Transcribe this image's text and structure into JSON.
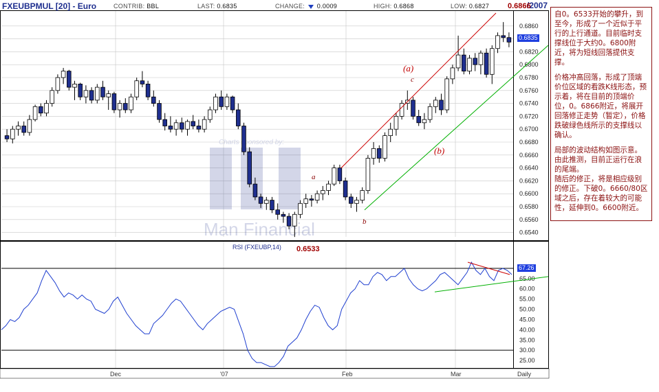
{
  "header": {
    "title": "FXEUBPMUL [20] - Euro",
    "contrib_label": "CONTRIB:",
    "contrib_value": "BBL",
    "last_label": "LAST:",
    "last_value": "0.6835",
    "change_label": "CHANGE:",
    "change_value": "0.0009",
    "high_label": "HIGH:",
    "high_value": "0.6868",
    "low_label": "LOW:",
    "low_value": "0.6827",
    "year": "/2007"
  },
  "annotations": {
    "peak_value": "0.6866",
    "low_value": "0.6533",
    "wave_a_big": "(a)",
    "wave_b_big": "(b)",
    "wave_a_small": "a",
    "wave_b_small": "b",
    "wave_c_small": "c",
    "last_price_box": "0.6835",
    "rsi_value_box": "67.26"
  },
  "watermark": {
    "sponsor_text": "Charts sponsored by:",
    "brand_text": "Man Financial"
  },
  "note": {
    "p1": "自0。6533开始的攀升，到至今，形成了一个近似于平行的上行通道。目前临时支撑线位于大约0。6800附近，将为短线回落提供支撑。",
    "p2": "价格冲高回落，形成了顶端价位区域的看跌K线形态，预示着，将在目前的顶端价位，0。6866附近，将展开回落修正走势（暂定），价格跌破绿色线所示的支撑线以确认。",
    "p3": "局部的波动结构如图示意。由此推测，目前正运行在浪的尾端。",
    "p4": "随后的修正，将是相应级别的修正。下破0。6660/80区域之后，存在着较大的可能性，延伸到0。6600附近。"
  },
  "colors": {
    "up_candle": "#ffffff",
    "down_candle": "#1f2f8f",
    "rsi_line": "#1f3fcf",
    "resistance_line": "#cc0000",
    "support_line": "#00b000",
    "grid": "#c8c8c8",
    "note_text": "#8b1010"
  },
  "chart_data": [
    {
      "type": "candlestick",
      "title": "FXEUBPMUL [20] - Euro",
      "frequency": "Daily",
      "ylim": [
        0.653,
        0.688
      ],
      "y_ticks": [
        0.654,
        0.656,
        0.658,
        0.66,
        0.662,
        0.664,
        0.666,
        0.668,
        0.67,
        0.672,
        0.674,
        0.676,
        0.678,
        0.68,
        0.682,
        0.684,
        0.686
      ],
      "x_ticks": [
        "Dec",
        "'07",
        "Feb",
        "Mar",
        "Daily"
      ],
      "grid": true,
      "candles": [
        {
          "o": 0.669,
          "h": 0.67,
          "l": 0.668,
          "c": 0.6685
        },
        {
          "o": 0.6685,
          "h": 0.6705,
          "l": 0.6678,
          "c": 0.67
        },
        {
          "o": 0.67,
          "h": 0.6712,
          "l": 0.669,
          "c": 0.6705
        },
        {
          "o": 0.6705,
          "h": 0.6712,
          "l": 0.669,
          "c": 0.6695
        },
        {
          "o": 0.6695,
          "h": 0.6722,
          "l": 0.669,
          "c": 0.6715
        },
        {
          "o": 0.6715,
          "h": 0.6738,
          "l": 0.6712,
          "c": 0.6735
        },
        {
          "o": 0.6735,
          "h": 0.674,
          "l": 0.672,
          "c": 0.6725
        },
        {
          "o": 0.6725,
          "h": 0.6745,
          "l": 0.672,
          "c": 0.674
        },
        {
          "o": 0.674,
          "h": 0.6765,
          "l": 0.6735,
          "c": 0.676
        },
        {
          "o": 0.676,
          "h": 0.6785,
          "l": 0.6755,
          "c": 0.678
        },
        {
          "o": 0.678,
          "h": 0.6795,
          "l": 0.677,
          "c": 0.679
        },
        {
          "o": 0.679,
          "h": 0.6792,
          "l": 0.676,
          "c": 0.6765
        },
        {
          "o": 0.6765,
          "h": 0.6775,
          "l": 0.6745,
          "c": 0.677
        },
        {
          "o": 0.677,
          "h": 0.6772,
          "l": 0.6745,
          "c": 0.675
        },
        {
          "o": 0.675,
          "h": 0.6768,
          "l": 0.674,
          "c": 0.676
        },
        {
          "o": 0.676,
          "h": 0.6765,
          "l": 0.674,
          "c": 0.6745
        },
        {
          "o": 0.6745,
          "h": 0.677,
          "l": 0.674,
          "c": 0.6765
        },
        {
          "o": 0.6765,
          "h": 0.6775,
          "l": 0.6745,
          "c": 0.675
        },
        {
          "o": 0.675,
          "h": 0.676,
          "l": 0.673,
          "c": 0.6755
        },
        {
          "o": 0.6755,
          "h": 0.6758,
          "l": 0.6725,
          "c": 0.673
        },
        {
          "o": 0.673,
          "h": 0.6745,
          "l": 0.6718,
          "c": 0.674
        },
        {
          "o": 0.674,
          "h": 0.6748,
          "l": 0.6725,
          "c": 0.673
        },
        {
          "o": 0.673,
          "h": 0.6755,
          "l": 0.6725,
          "c": 0.675
        },
        {
          "o": 0.675,
          "h": 0.678,
          "l": 0.6745,
          "c": 0.6775
        },
        {
          "o": 0.6775,
          "h": 0.679,
          "l": 0.6765,
          "c": 0.677
        },
        {
          "o": 0.677,
          "h": 0.6775,
          "l": 0.6745,
          "c": 0.675
        },
        {
          "o": 0.675,
          "h": 0.676,
          "l": 0.6735,
          "c": 0.674
        },
        {
          "o": 0.674,
          "h": 0.6745,
          "l": 0.671,
          "c": 0.6715
        },
        {
          "o": 0.6715,
          "h": 0.6725,
          "l": 0.6698,
          "c": 0.6705
        },
        {
          "o": 0.6705,
          "h": 0.672,
          "l": 0.6695,
          "c": 0.67
        },
        {
          "o": 0.67,
          "h": 0.6715,
          "l": 0.669,
          "c": 0.671
        },
        {
          "o": 0.671,
          "h": 0.6718,
          "l": 0.6695,
          "c": 0.67
        },
        {
          "o": 0.67,
          "h": 0.6715,
          "l": 0.669,
          "c": 0.6712
        },
        {
          "o": 0.6712,
          "h": 0.6722,
          "l": 0.67,
          "c": 0.6705
        },
        {
          "o": 0.6705,
          "h": 0.6715,
          "l": 0.6695,
          "c": 0.67
        },
        {
          "o": 0.67,
          "h": 0.672,
          "l": 0.6695,
          "c": 0.6715
        },
        {
          "o": 0.6715,
          "h": 0.6735,
          "l": 0.671,
          "c": 0.673
        },
        {
          "o": 0.673,
          "h": 0.6755,
          "l": 0.6725,
          "c": 0.675
        },
        {
          "o": 0.675,
          "h": 0.676,
          "l": 0.673,
          "c": 0.6735
        },
        {
          "o": 0.6735,
          "h": 0.6755,
          "l": 0.673,
          "c": 0.675
        },
        {
          "o": 0.675,
          "h": 0.6752,
          "l": 0.6725,
          "c": 0.673
        },
        {
          "o": 0.673,
          "h": 0.674,
          "l": 0.67,
          "c": 0.6705
        },
        {
          "o": 0.6705,
          "h": 0.671,
          "l": 0.666,
          "c": 0.6665
        },
        {
          "o": 0.6665,
          "h": 0.6672,
          "l": 0.661,
          "c": 0.6615
        },
        {
          "o": 0.6615,
          "h": 0.6625,
          "l": 0.659,
          "c": 0.6595
        },
        {
          "o": 0.6595,
          "h": 0.66,
          "l": 0.6578,
          "c": 0.6585
        },
        {
          "o": 0.6585,
          "h": 0.6595,
          "l": 0.6575,
          "c": 0.659
        },
        {
          "o": 0.659,
          "h": 0.6595,
          "l": 0.657,
          "c": 0.6575
        },
        {
          "o": 0.6575,
          "h": 0.6585,
          "l": 0.656,
          "c": 0.6568
        },
        {
          "o": 0.6568,
          "h": 0.6572,
          "l": 0.6555,
          "c": 0.6565
        },
        {
          "o": 0.6565,
          "h": 0.657,
          "l": 0.6545,
          "c": 0.655
        },
        {
          "o": 0.655,
          "h": 0.6572,
          "l": 0.6533,
          "c": 0.6568
        },
        {
          "o": 0.6568,
          "h": 0.659,
          "l": 0.6562,
          "c": 0.6585
        },
        {
          "o": 0.6585,
          "h": 0.66,
          "l": 0.6578,
          "c": 0.6592
        },
        {
          "o": 0.6592,
          "h": 0.6598,
          "l": 0.658,
          "c": 0.659
        },
        {
          "o": 0.659,
          "h": 0.6605,
          "l": 0.6585,
          "c": 0.66
        },
        {
          "o": 0.66,
          "h": 0.6612,
          "l": 0.659,
          "c": 0.6605
        },
        {
          "o": 0.6605,
          "h": 0.662,
          "l": 0.6598,
          "c": 0.6615
        },
        {
          "o": 0.6615,
          "h": 0.6645,
          "l": 0.6612,
          "c": 0.664
        },
        {
          "o": 0.664,
          "h": 0.6645,
          "l": 0.6615,
          "c": 0.662
        },
        {
          "o": 0.662,
          "h": 0.6625,
          "l": 0.659,
          "c": 0.6595
        },
        {
          "o": 0.6595,
          "h": 0.66,
          "l": 0.6578,
          "c": 0.6585
        },
        {
          "o": 0.6585,
          "h": 0.6595,
          "l": 0.6572,
          "c": 0.659
        },
        {
          "o": 0.659,
          "h": 0.661,
          "l": 0.6585,
          "c": 0.6605
        },
        {
          "o": 0.6605,
          "h": 0.666,
          "l": 0.66,
          "c": 0.6655
        },
        {
          "o": 0.6655,
          "h": 0.668,
          "l": 0.6645,
          "c": 0.667
        },
        {
          "o": 0.667,
          "h": 0.6675,
          "l": 0.6648,
          "c": 0.6655
        },
        {
          "o": 0.6655,
          "h": 0.6695,
          "l": 0.665,
          "c": 0.669
        },
        {
          "o": 0.669,
          "h": 0.671,
          "l": 0.668,
          "c": 0.67
        },
        {
          "o": 0.67,
          "h": 0.6725,
          "l": 0.669,
          "c": 0.672
        },
        {
          "o": 0.672,
          "h": 0.6745,
          "l": 0.6715,
          "c": 0.674
        },
        {
          "o": 0.674,
          "h": 0.676,
          "l": 0.673,
          "c": 0.6745
        },
        {
          "o": 0.6745,
          "h": 0.675,
          "l": 0.6715,
          "c": 0.672
        },
        {
          "o": 0.672,
          "h": 0.673,
          "l": 0.6705,
          "c": 0.671
        },
        {
          "o": 0.671,
          "h": 0.6725,
          "l": 0.67,
          "c": 0.6715
        },
        {
          "o": 0.6715,
          "h": 0.674,
          "l": 0.671,
          "c": 0.6735
        },
        {
          "o": 0.6735,
          "h": 0.675,
          "l": 0.6725,
          "c": 0.6745
        },
        {
          "o": 0.6745,
          "h": 0.6755,
          "l": 0.6722,
          "c": 0.673
        },
        {
          "o": 0.673,
          "h": 0.6782,
          "l": 0.6725,
          "c": 0.6778
        },
        {
          "o": 0.6778,
          "h": 0.68,
          "l": 0.677,
          "c": 0.6795
        },
        {
          "o": 0.6795,
          "h": 0.6845,
          "l": 0.679,
          "c": 0.6815
        },
        {
          "o": 0.6815,
          "h": 0.6825,
          "l": 0.6785,
          "c": 0.679
        },
        {
          "o": 0.679,
          "h": 0.6815,
          "l": 0.6785,
          "c": 0.681
        },
        {
          "o": 0.681,
          "h": 0.6818,
          "l": 0.679,
          "c": 0.68
        },
        {
          "o": 0.68,
          "h": 0.6822,
          "l": 0.6785,
          "c": 0.6818
        },
        {
          "o": 0.6818,
          "h": 0.6825,
          "l": 0.678,
          "c": 0.6785
        },
        {
          "o": 0.6785,
          "h": 0.683,
          "l": 0.677,
          "c": 0.6825
        },
        {
          "o": 0.6825,
          "h": 0.685,
          "l": 0.6818,
          "c": 0.6845
        },
        {
          "o": 0.6845,
          "h": 0.6866,
          "l": 0.6835,
          "c": 0.6842
        },
        {
          "o": 0.6842,
          "h": 0.685,
          "l": 0.6827,
          "c": 0.6835
        }
      ]
    },
    {
      "type": "line",
      "title": "RSI (FXEUBP,14)",
      "ylim": [
        20,
        75
      ],
      "y_ticks": [
        25,
        30,
        35,
        40,
        45,
        50,
        55,
        60,
        65,
        70
      ],
      "reference_lines": [
        70,
        30
      ],
      "series": [
        {
          "values": [
            40,
            42,
            45,
            44,
            46,
            50,
            52,
            55,
            58,
            64,
            69,
            66,
            63,
            59,
            56,
            58,
            57,
            55,
            57,
            55,
            54,
            50,
            49,
            48,
            50,
            54,
            56,
            52,
            48,
            45,
            42,
            40,
            38,
            38,
            43,
            45,
            47,
            50,
            53,
            55,
            54,
            51,
            48,
            45,
            42,
            40,
            43,
            45,
            47,
            49,
            50,
            51,
            50,
            44,
            38,
            30,
            26,
            24,
            24,
            23,
            22,
            22,
            24,
            27,
            32,
            34,
            36,
            40,
            45,
            49,
            52,
            51,
            46,
            42,
            40,
            42,
            50,
            54,
            58,
            60,
            64,
            62,
            62,
            66,
            68,
            67,
            64,
            66,
            66,
            68,
            70,
            65,
            62,
            60,
            59,
            60,
            62,
            64,
            67,
            68,
            66,
            64,
            62,
            65,
            68,
            73,
            69,
            67,
            70,
            66,
            64,
            69,
            70,
            69,
            67
          ]
        }
      ]
    }
  ]
}
